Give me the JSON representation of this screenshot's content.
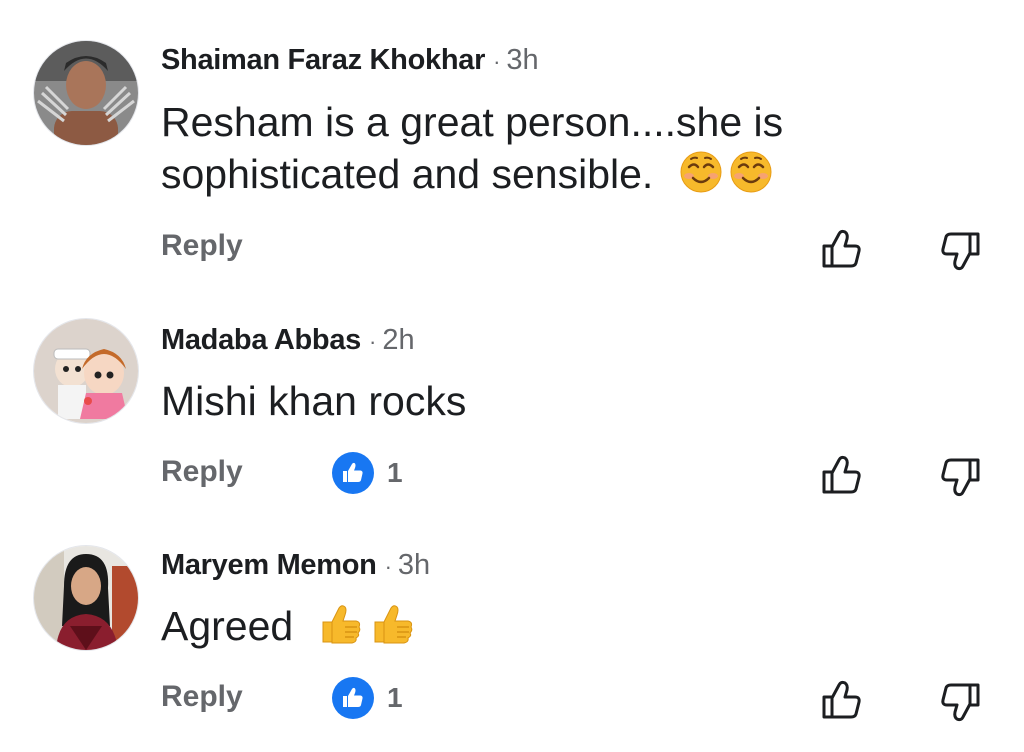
{
  "comments": [
    {
      "author": "Shaiman Faraz Khokhar",
      "separator": "·",
      "time": "3h",
      "text_lines": [
        "Resham is a great person....she is",
        "sophisticated and sensible."
      ],
      "emojis": [
        "smiling-face-icon",
        "smiling-face-icon"
      ],
      "reply_label": "Reply",
      "reaction_count": null
    },
    {
      "author": "Madaba Abbas",
      "separator": "·",
      "time": "2h",
      "text_lines": [
        "Mishi khan rocks"
      ],
      "emojis": [],
      "reply_label": "Reply",
      "reaction_count": "1"
    },
    {
      "author": "Maryem Memon",
      "separator": "·",
      "time": "3h",
      "text_lines": [
        "Agreed"
      ],
      "emojis": [
        "thumbs-up-emoji-icon",
        "thumbs-up-emoji-icon"
      ],
      "reply_label": "Reply",
      "reaction_count": "1"
    }
  ],
  "colors": {
    "text_primary": "#1c1e21",
    "text_secondary": "#65676b",
    "like_blue": "#1877f2",
    "emoji_yellow": "#f7b92b"
  },
  "icons": {
    "like": "thumbs-up-outline-icon",
    "dislike": "thumbs-down-outline-icon",
    "reaction": "like-reaction-icon"
  }
}
